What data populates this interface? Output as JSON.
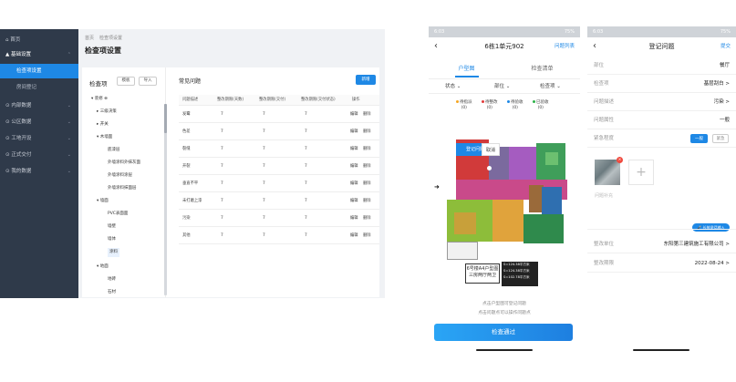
{
  "web": {
    "sidebar": [
      {
        "label": "首页",
        "icon": "home-icon",
        "chevron": ""
      },
      {
        "label": "▲ 基础设置",
        "icon": "",
        "chevron": "⌃"
      },
      {
        "label": "检查项设置",
        "icon": "",
        "chevron": ""
      },
      {
        "label": "房间登记",
        "icon": "",
        "chevron": ""
      },
      {
        "label": "内部数据",
        "icon": "",
        "chevron": "⌄"
      },
      {
        "label": "公区数据",
        "icon": "",
        "chevron": "⌄"
      },
      {
        "label": "工地开设",
        "icon": "",
        "chevron": "⌄"
      },
      {
        "label": "正式交付",
        "icon": "",
        "chevron": "⌄"
      },
      {
        "label": "我的数据",
        "icon": "",
        "chevron": "⌄"
      }
    ],
    "breadcrumb": [
      "首页",
      "检查项设置"
    ],
    "title": "检查项设置",
    "tree_title": "检查项",
    "tree_btn_template": "模板",
    "tree_btn_import": "导入",
    "tree": [
      "▾ 装修 ⊕",
      "▸ 三级决策",
      "▸ 开关",
      "▾ 木墙面",
      "底漆层",
      "外墙涂料外抹灰面",
      "外墙涂料涂层",
      "外墙涂料抹面层",
      "▾ 墙面",
      "PVC表面面",
      "墙壁",
      "墙体",
      "涂料",
      "▾ 地面",
      "地砖",
      "石材"
    ],
    "problem_title": "常见问题",
    "add_label": "新增",
    "columns": [
      "问题描述",
      "整改期限(天数)",
      "整改期限(交付)",
      "整改期限(交付状态)",
      "操作"
    ],
    "rows": [
      {
        "desc": "发霉",
        "c1": "7",
        "c2": "7",
        "c3": "7"
      },
      {
        "desc": "色差",
        "c1": "7",
        "c2": "7",
        "c3": "7"
      },
      {
        "desc": "裂缝",
        "c1": "7",
        "c2": "7",
        "c3": "7"
      },
      {
        "desc": "开裂",
        "c1": "7",
        "c2": "7",
        "c3": "7"
      },
      {
        "desc": "垂直不平",
        "c1": "7",
        "c2": "7",
        "c3": "7"
      },
      {
        "desc": "未打磨上漆",
        "c1": "7",
        "c2": "7",
        "c3": "7"
      },
      {
        "desc": "污染",
        "c1": "7",
        "c2": "7",
        "c3": "7"
      },
      {
        "desc": "其他",
        "c1": "7",
        "c2": "7",
        "c3": "7"
      }
    ],
    "edit_label": "编辑",
    "delete_label": "删除"
  },
  "phone2": {
    "time": "6:03",
    "battery": "75%",
    "title": "6栋1单元902",
    "right": "问题列表",
    "tabs": [
      "户型图",
      "检查清单"
    ],
    "filters": [
      "状态 ⌄",
      "部位 ⌄",
      "检查项 ⌄"
    ],
    "legend": [
      {
        "label": "待指派",
        "count": "(0)",
        "color": "#f5a623"
      },
      {
        "label": "待整改",
        "count": "(0)",
        "color": "#e23b3b"
      },
      {
        "label": "待验收",
        "count": "(0)",
        "color": "#1e88e5"
      },
      {
        "label": "已验收",
        "count": "(0)",
        "color": "#2fb24a"
      }
    ],
    "popup_register": "登记问题",
    "popup_cancel": "取消",
    "plan_label": "6号楼A4户型图 三房两厅两卫",
    "plan_info": [
      "S=124.38平方米",
      "S=124.38平方米",
      "S=102.78平方米"
    ],
    "hint1": "点击户型图可登记问题",
    "hint2": "点击问题点可以操作问题点",
    "pass_label": "检查通过"
  },
  "phone3": {
    "time": "6:03",
    "battery": "75%",
    "title": "登记问题",
    "submit": "提交",
    "fields": [
      {
        "label": "部位",
        "value": "餐厅"
      },
      {
        "label": "检查项",
        "value": "基层刮白 >"
      },
      {
        "label": "问题描述",
        "value": "污染 >"
      },
      {
        "label": "问题属性",
        "value": "一般"
      }
    ],
    "urgency_label": "紧急程度",
    "urgency_options": [
      "一般",
      "紧急"
    ],
    "remark": "问题补充",
    "voice": "🎤 长按说话输入",
    "unit_label": "整改单位",
    "unit_value": "东阳第三建筑施工有限公司 >",
    "deadline_label": "整改期限",
    "deadline_value": "2022-08-24 >"
  }
}
